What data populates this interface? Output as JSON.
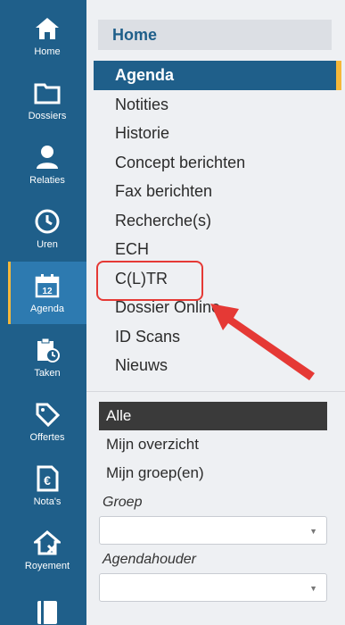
{
  "rail": {
    "items": [
      {
        "label": "Home",
        "icon": "home-icon"
      },
      {
        "label": "Dossiers",
        "icon": "folder-icon"
      },
      {
        "label": "Relaties",
        "icon": "person-icon"
      },
      {
        "label": "Uren",
        "icon": "clock-icon"
      },
      {
        "label": "Agenda",
        "icon": "calendar-icon"
      },
      {
        "label": "Taken",
        "icon": "clipboard-clock-icon"
      },
      {
        "label": "Offertes",
        "icon": "tag-icon"
      },
      {
        "label": "Nota's",
        "icon": "euro-document-icon"
      },
      {
        "label": "Royement",
        "icon": "house-x-icon"
      },
      {
        "label": "",
        "icon": "book-icon"
      }
    ],
    "active": "Agenda"
  },
  "panel": {
    "header": "Home",
    "menu": [
      "Agenda",
      "Notities",
      "Historie",
      "Concept berichten",
      "Fax berichten",
      "Recherche(s)",
      "ECH",
      "C(L)TR",
      "Dossier Online",
      "ID Scans",
      "Nieuws"
    ],
    "active_menu": "Agenda",
    "filter": {
      "items": [
        "Alle",
        "Mijn overzicht",
        "Mijn groep(en)"
      ],
      "active": "Alle",
      "groep_label": "Groep",
      "agendahouder_label": "Agendahouder"
    }
  },
  "colors": {
    "rail": "#1f5f8a",
    "accent": "#f5b83a",
    "annotation": "#e53935"
  }
}
